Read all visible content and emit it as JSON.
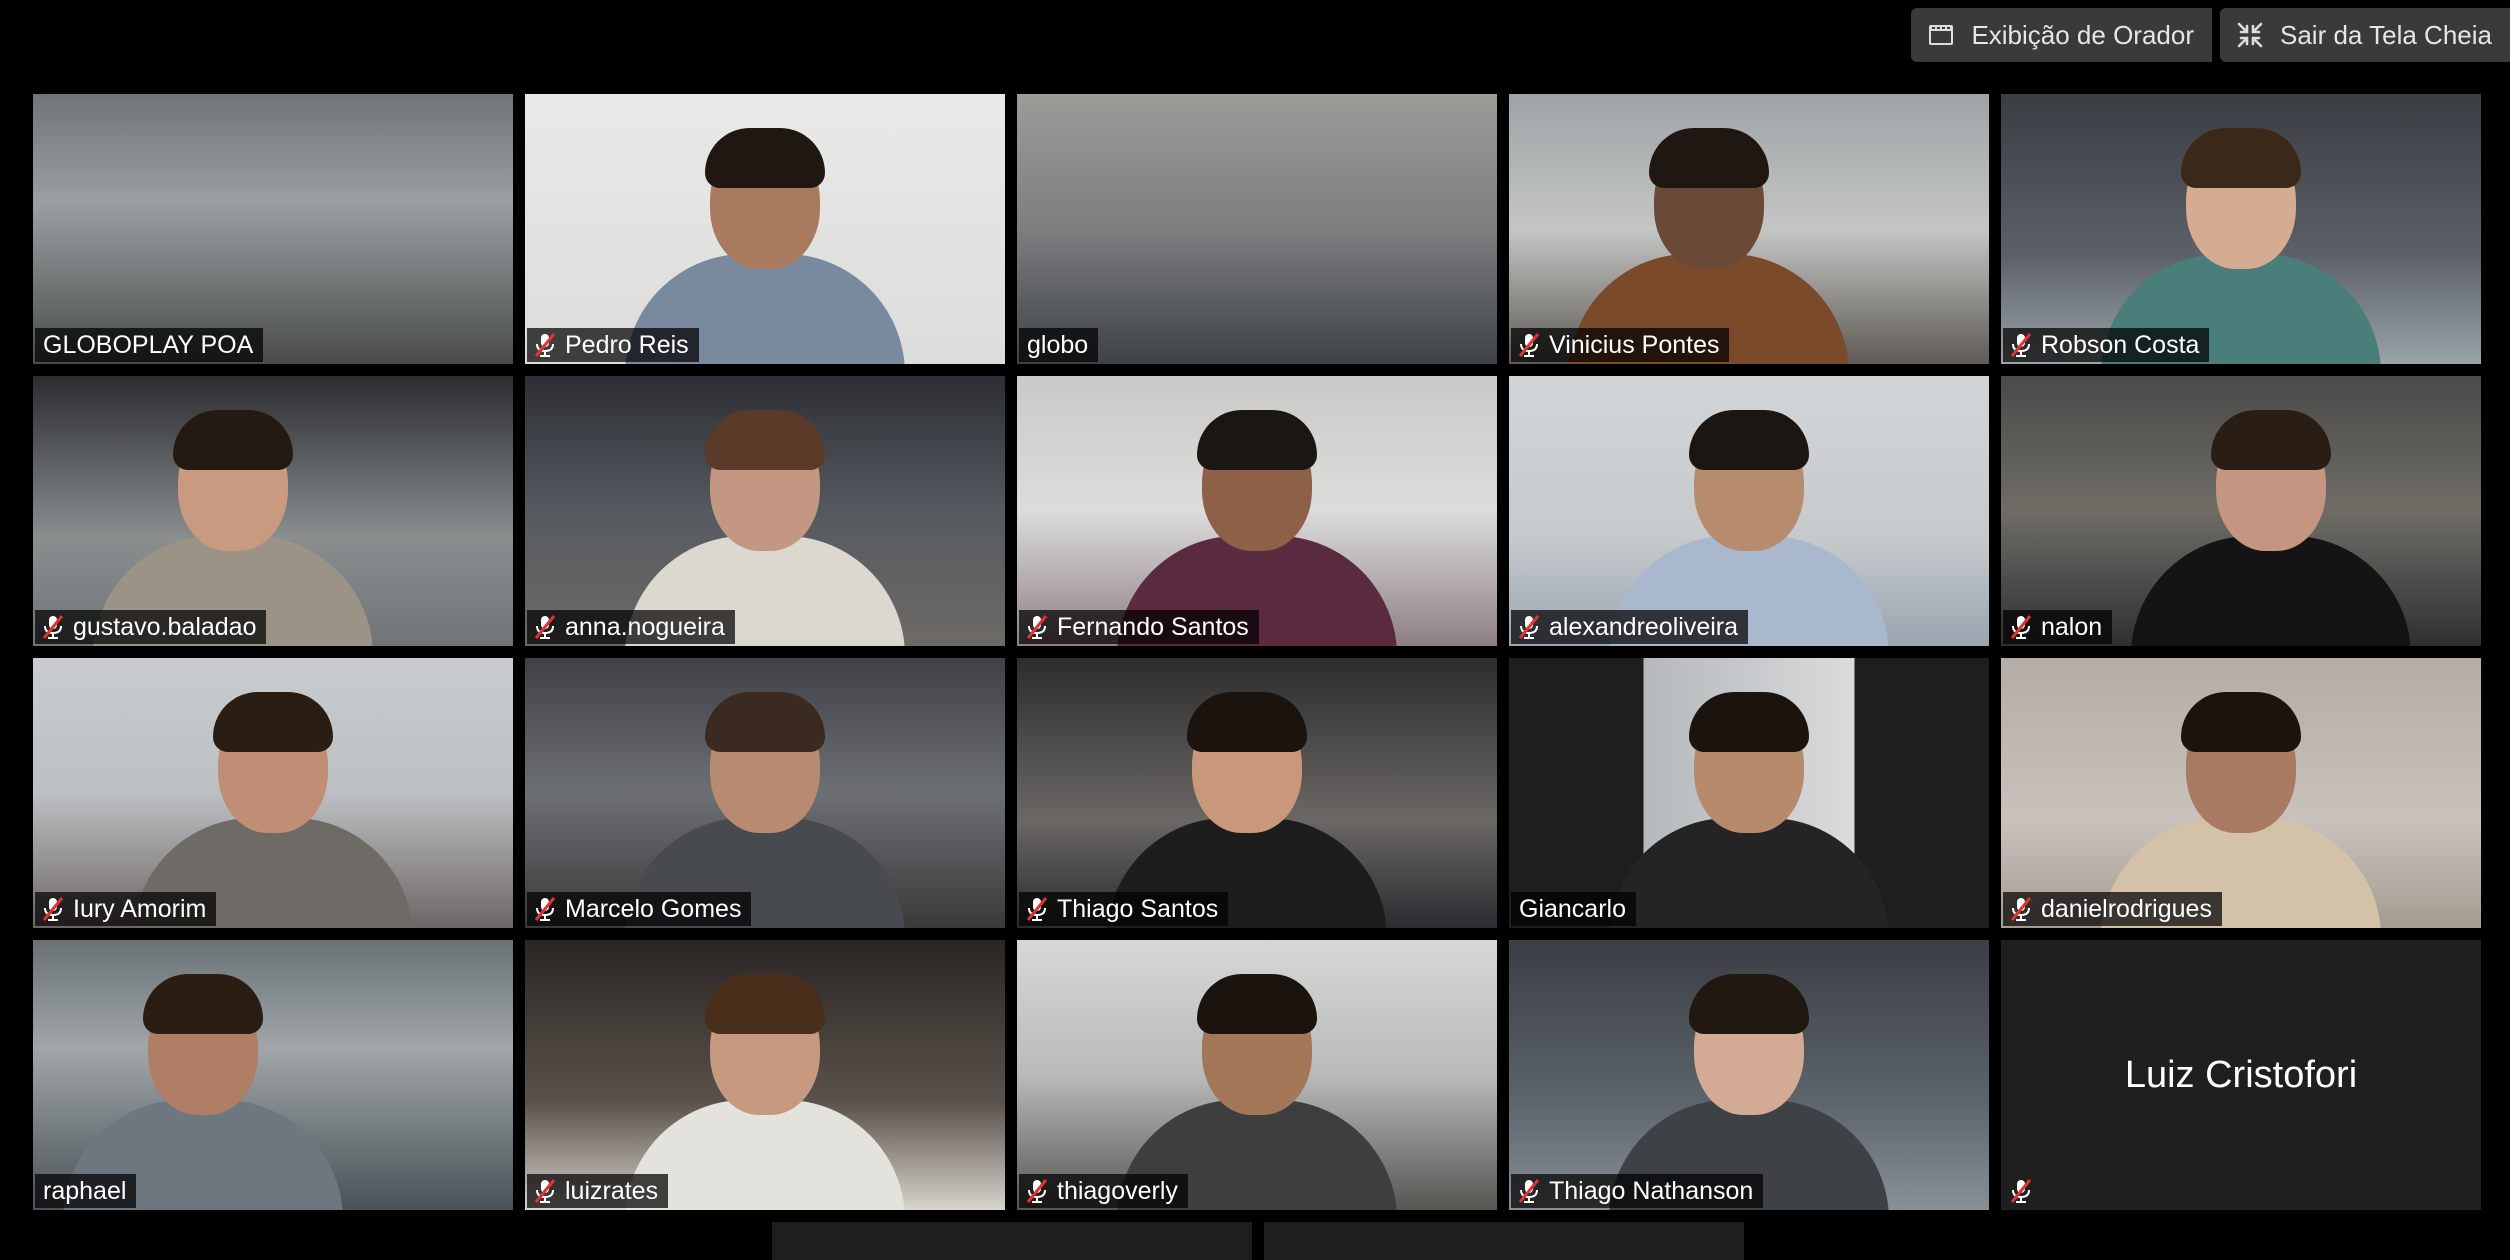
{
  "toolbar": {
    "speaker_view_label": "Exibição de Orador",
    "exit_fullscreen_label": "Sair da Tela Cheia"
  },
  "participants": [
    {
      "name": "GLOBOPLAY POA",
      "muted": false
    },
    {
      "name": "Pedro Reis",
      "muted": true
    },
    {
      "name": "globo",
      "muted": false
    },
    {
      "name": "Vinicius Pontes",
      "muted": true
    },
    {
      "name": "Robson Costa",
      "muted": true
    },
    {
      "name": "gustavo.baladao",
      "muted": true
    },
    {
      "name": "anna.nogueira",
      "muted": true
    },
    {
      "name": "Fernando Santos",
      "muted": true
    },
    {
      "name": "alexandreoliveira",
      "muted": true
    },
    {
      "name": "nalon",
      "muted": true
    },
    {
      "name": "Iury Amorim",
      "muted": true
    },
    {
      "name": "Marcelo Gomes",
      "muted": true
    },
    {
      "name": "Thiago Santos",
      "muted": true
    },
    {
      "name": "Giancarlo",
      "muted": false,
      "active_speaker": true
    },
    {
      "name": "danielrodrigues",
      "muted": true
    },
    {
      "name": "raphael",
      "muted": false
    },
    {
      "name": "luizrates",
      "muted": true
    },
    {
      "name": "thiagoverly",
      "muted": true
    },
    {
      "name": "Thiago Nathanson",
      "muted": true
    },
    {
      "name": "Luiz Cristofori",
      "muted": true,
      "video_off": true
    }
  ],
  "colors": {
    "active_speaker_border": "#e8e06d",
    "muted_icon": "#e0332f",
    "toolbar_button_bg": "#3a3a3c"
  }
}
